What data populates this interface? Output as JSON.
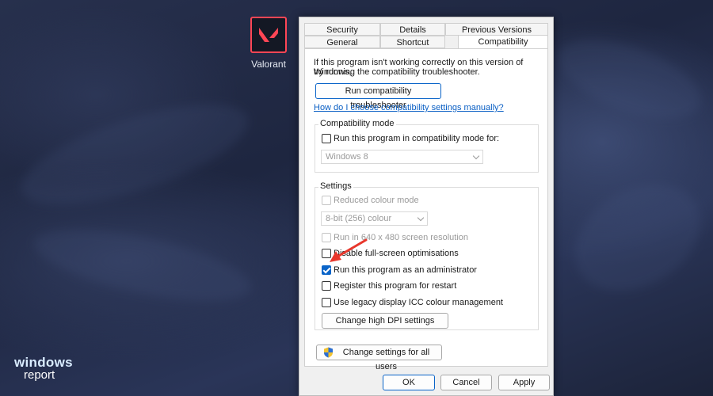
{
  "desktop": {
    "icon_label": "Valorant",
    "icon_name": "valorant-logo-icon",
    "accent_color": "#ff4655"
  },
  "watermark": {
    "line1": "windows",
    "line2": "report"
  },
  "dialog": {
    "tabs_row1": [
      "Security",
      "Details",
      "Previous Versions"
    ],
    "tabs_row2": [
      "General",
      "Shortcut",
      "Compatibility"
    ],
    "active_tab": "Compatibility",
    "intro_line1": "If this program isn't working correctly on this version of Windows,",
    "intro_line2": "try running the compatibility troubleshooter.",
    "troubleshooter_button": "Run compatibility troubleshooter",
    "help_link": "How do I choose compatibility settings manually?",
    "compat_mode": {
      "title": "Compatibility mode",
      "checkbox_label": "Run this program in compatibility mode for:",
      "checked": false,
      "select_value": "Windows 8"
    },
    "settings": {
      "title": "Settings",
      "reduced_colour_label": "Reduced colour mode",
      "colour_select_value": "8-bit (256) colour",
      "resolution_label": "Run in 640 x 480 screen resolution",
      "fullscreen_label": "Disable full-screen optimisations",
      "admin_label": "Run this program as an administrator",
      "admin_checked": true,
      "restart_label": "Register this program for restart",
      "icc_label": "Use legacy display ICC colour management",
      "dpi_button": "Change high DPI settings"
    },
    "all_users_button": "Change settings for all users",
    "ok": "OK",
    "cancel": "Cancel",
    "apply": "Apply",
    "annotation_arrow_color": "#e8372c",
    "checkbox_accent": "#0a64c8"
  }
}
